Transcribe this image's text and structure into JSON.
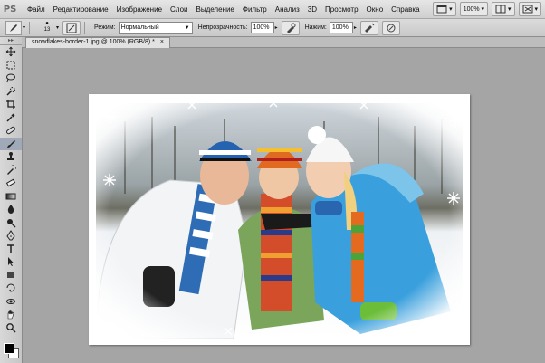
{
  "app": {
    "logo": "PS"
  },
  "menu": [
    "Файл",
    "Редактирование",
    "Изображение",
    "Слои",
    "Выделение",
    "Фильтр",
    "Анализ",
    "3D",
    "Просмотр",
    "Окно",
    "Справка"
  ],
  "menu_right": {
    "zoom": "100%"
  },
  "options": {
    "brush_size": "13",
    "mode_label": "Режим:",
    "mode_value": "Нормальный",
    "opacity_label": "Непрозрачность:",
    "opacity_value": "100%",
    "pressure_label": "Нажим:",
    "pressure_value": "100%"
  },
  "document": {
    "tab_title": "snowflakes-border-1.jpg @ 100% (RGB/8) *"
  },
  "tools": [
    "move",
    "marquee",
    "lasso",
    "quick-select",
    "crop",
    "eyedropper",
    "healing",
    "brush",
    "stamp",
    "history-brush",
    "eraser",
    "gradient",
    "blur",
    "dodge",
    "pen",
    "type",
    "path-select",
    "shape",
    "3d-rotate",
    "3d-orbit",
    "hand",
    "zoom"
  ],
  "active_tool": "brush"
}
